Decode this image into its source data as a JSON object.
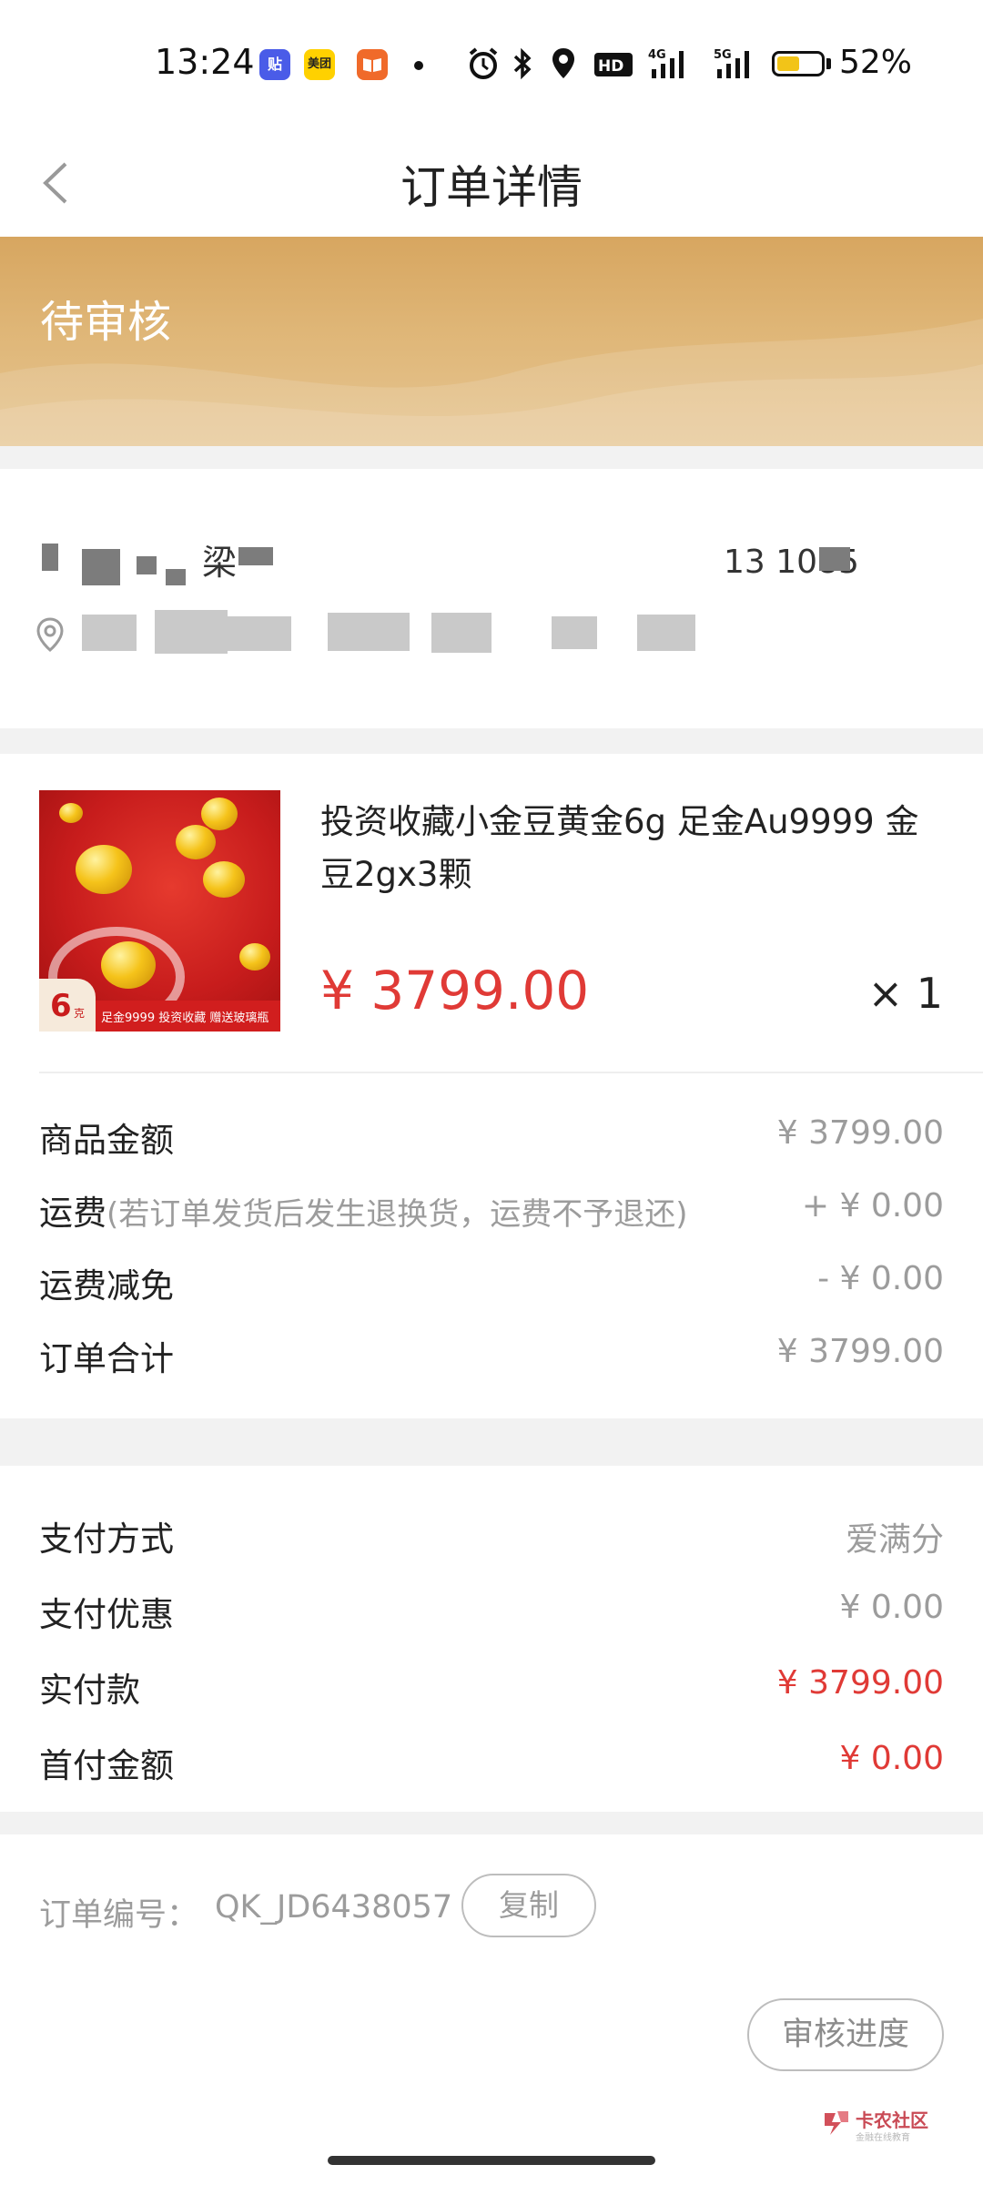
{
  "status_bar": {
    "time": "13:24",
    "app_icons": [
      {
        "name": "tieba-app-icon",
        "glyph": "贴",
        "color": "#4a5ce8"
      },
      {
        "name": "meituan-app-icon",
        "glyph": "美团",
        "color": "#ffd100"
      },
      {
        "name": "reader-app-icon",
        "glyph": "",
        "color": "#f06a2a"
      }
    ],
    "battery_percent": "52%",
    "battery_level": 0.52,
    "network_labels": [
      "4G",
      "5G"
    ],
    "hd_label": "HD"
  },
  "nav": {
    "title": "订单详情"
  },
  "banner": {
    "status": "待审核"
  },
  "address": {
    "name_visible": "梁",
    "phone_visible": "13 1085"
  },
  "product": {
    "title": "投资收藏小金豆黄金6g 足金Au9999 金豆2gx3颗",
    "price": "¥ 3799.00",
    "quantity": "× 1",
    "thumb_badge": "6",
    "thumb_badge_unit": "克",
    "thumb_band_text": "足金9999 投资收藏 赠送玻璃瓶"
  },
  "fees": [
    {
      "label": "商品金额",
      "note": "",
      "value": "¥ 3799.00"
    },
    {
      "label": "运费",
      "note": "(若订单发货后发生退换货，运费不予退还)",
      "value": "+ ¥ 0.00"
    },
    {
      "label": "运费减免",
      "note": "",
      "value": "- ¥ 0.00"
    },
    {
      "label": "订单合计",
      "note": "",
      "value": "¥ 3799.00"
    }
  ],
  "payment": [
    {
      "label": "支付方式",
      "value": "爱满分",
      "highlight": false
    },
    {
      "label": "支付优惠",
      "value": "¥ 0.00",
      "highlight": false
    },
    {
      "label": "实付款",
      "value": "¥ 3799.00",
      "highlight": true
    },
    {
      "label": "首付金额",
      "value": "¥ 0.00",
      "highlight": true
    }
  ],
  "order": {
    "number_label": "订单编号：",
    "number": "QK_JD6438057",
    "copy_label": "复制",
    "review_label": "审核进度"
  },
  "watermark": {
    "title": "卡农社区",
    "subtitle": "金融在线教育"
  },
  "colors": {
    "accent_red": "#e03a36",
    "banner_gold": "#d7a660",
    "muted_text": "#9c9c9c"
  }
}
